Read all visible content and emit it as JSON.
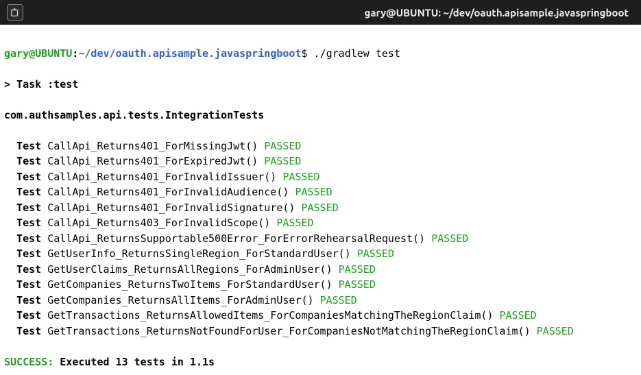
{
  "titlebar": {
    "title": "gary@UBUNTU: ~/dev/oauth.apisample.javaspringboot"
  },
  "prompt": {
    "user_host": "gary@UBUNTU",
    "colon": ":",
    "path": "~/dev/oauth.apisample.javaspringboot",
    "dollar": "$",
    "command": "./gradlew test"
  },
  "task_line": "> Task :test",
  "suite_name": "com.authsamples.api.tests.IntegrationTests",
  "test_label": "Test",
  "pass_label": "PASSED",
  "tests": [
    "CallApi_Returns401_ForMissingJwt()",
    "CallApi_Returns401_ForExpiredJwt()",
    "CallApi_Returns401_ForInvalidIssuer()",
    "CallApi_Returns401_ForInvalidAudience()",
    "CallApi_Returns401_ForInvalidSignature()",
    "CallApi_Returns403_ForInvalidScope()",
    "CallApi_ReturnsSupportable500Error_ForErrorRehearsalRequest()",
    "GetUserInfo_ReturnsSingleRegion_ForStandardUser()",
    "GetUserClaims_ReturnsAllRegions_ForAdminUser()",
    "GetCompanies_ReturnsTwoItems_ForStandardUser()",
    "GetCompanies_ReturnsAllItems_ForAdminUser()",
    "GetTransactions_ReturnsAllowedItems_ForCompaniesMatchingTheRegionClaim()",
    "GetTransactions_ReturnsNotFoundForUser_ForCompaniesNotMatchingTheRegionClaim()"
  ],
  "summary": {
    "label": "SUCCESS:",
    "text": "Executed 13 tests in 1.1s"
  }
}
